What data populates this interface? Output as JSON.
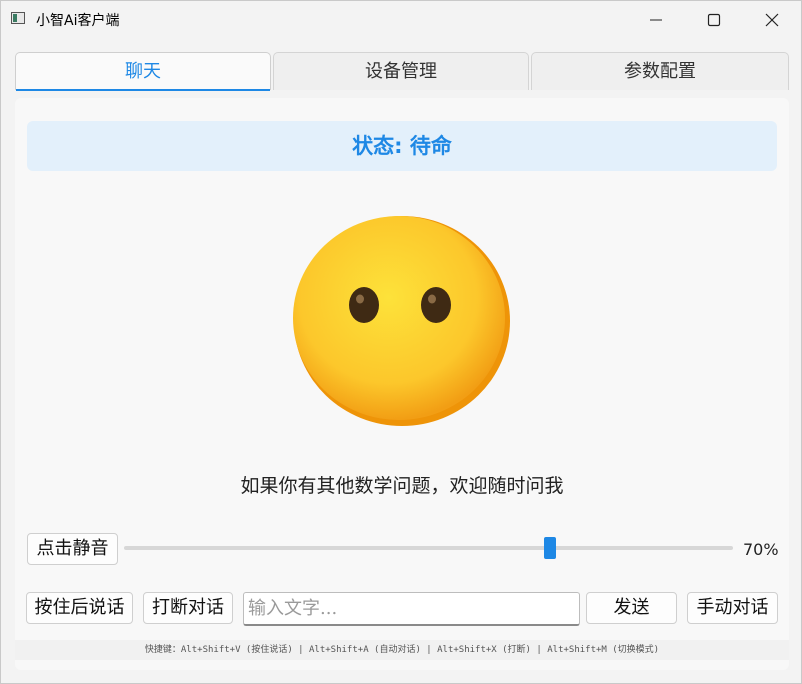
{
  "window": {
    "title": "小智Ai客户端",
    "icon": "app-window-icon",
    "controls": [
      "minimize-icon",
      "maximize-icon",
      "close-icon"
    ]
  },
  "tabs": [
    {
      "label": "聊天",
      "active": true
    },
    {
      "label": "设备管理",
      "active": false
    },
    {
      "label": "参数配置",
      "active": false
    }
  ],
  "chat": {
    "status": "状态: 待命",
    "emoji": "neutral-face-emoji",
    "message": "如果你有其他数学问题，欢迎随时问我",
    "mute_label": "点击静音",
    "volume": 70,
    "volume_text": "70%",
    "push_to_talk_label": "按住后说话",
    "interrupt_label": "打断对话",
    "input_placeholder": "输入文字...",
    "input_value": "",
    "send_label": "发送",
    "manual_label": "手动对话",
    "shortcuts": "快捷键：Alt+Shift+V (按住说话) | Alt+Shift+A (自动对话) | Alt+Shift+X (打断) | Alt+Shift+M (切换模式)"
  },
  "colors": {
    "accent": "#1e88e5",
    "status_background": "#e3f0fb"
  }
}
